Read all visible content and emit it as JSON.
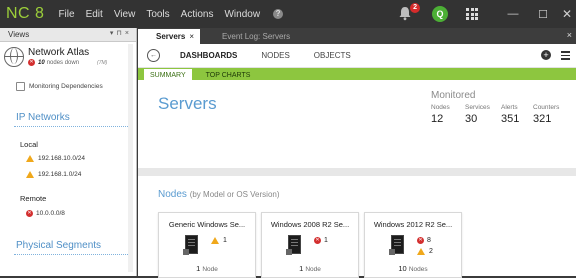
{
  "app": {
    "logo": "NC 8",
    "menu": [
      "File",
      "Edit",
      "View",
      "Tools",
      "Actions",
      "Window"
    ],
    "notification_count": "2",
    "user_initial": "Q"
  },
  "left": {
    "header": "Views",
    "atlas_title": "Network Atlas",
    "atlas_count": "10",
    "atlas_status": "nodes down",
    "atlas_tag": "(7M)",
    "monitoring_dep": "Monitoring Dependencies",
    "ip_networks": "IP Networks",
    "local_label": "Local",
    "local_ips": [
      "192.168.10.0/24",
      "192.168.1.0/24"
    ],
    "remote_label": "Remote",
    "remote_ips": [
      "10.0.0.0/8"
    ],
    "physical_segments": "Physical Segments"
  },
  "tabs": [
    {
      "label": "Servers",
      "close": "×"
    },
    {
      "label": "Event Log: Servers",
      "close": "×"
    }
  ],
  "nav": {
    "items": [
      "DASHBOARDS",
      "NODES",
      "OBJECTS"
    ],
    "sub_items": [
      "SUMMARY",
      "TOP CHARTS"
    ]
  },
  "summary": {
    "title": "Servers",
    "monitored_label": "Monitored",
    "stats": [
      {
        "label": "Nodes",
        "value": "12"
      },
      {
        "label": "Services",
        "value": "30"
      },
      {
        "label": "Alerts",
        "value": "351"
      },
      {
        "label": "Counters",
        "value": "321"
      }
    ]
  },
  "nodes": {
    "title": "Nodes",
    "subtitle": "(by Model or OS Version)",
    "cards": [
      {
        "title": "Generic Windows Se...",
        "warn": "1",
        "err": null,
        "count": "1",
        "unit": "Node"
      },
      {
        "title": "Windows 2008 R2 Se...",
        "warn": null,
        "err": "1",
        "count": "1",
        "unit": "Node"
      },
      {
        "title": "Windows 2012 R2 Se...",
        "warn": "2",
        "err": "8",
        "count": "10",
        "unit": "Nodes"
      }
    ]
  },
  "colors": {
    "accent_green": "#8dc63f",
    "title_blue": "#5a9bd0",
    "warning": "#f0a81b",
    "error": "#d32f2f"
  }
}
